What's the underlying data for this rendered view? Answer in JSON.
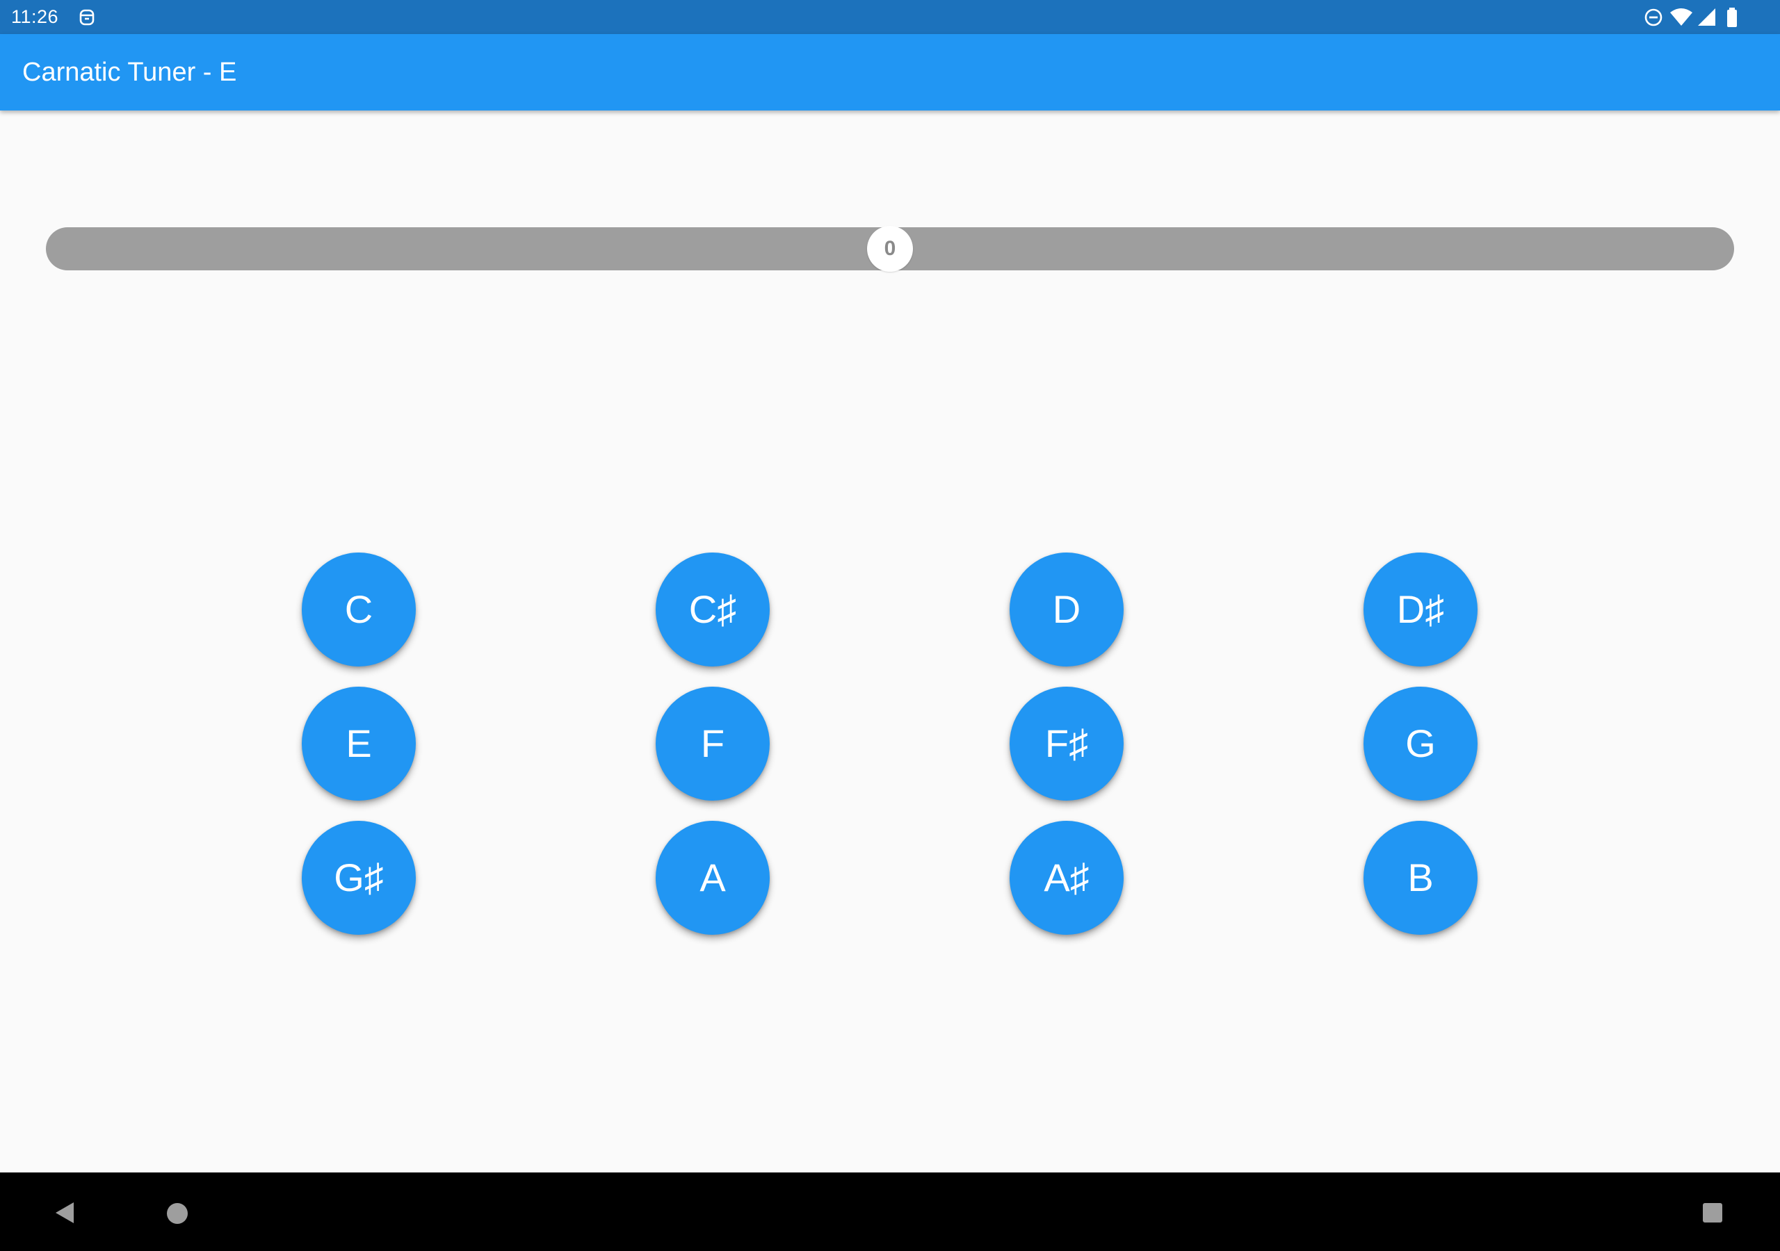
{
  "status_bar": {
    "time": "11:26",
    "left_icons": [
      "notification-icon"
    ],
    "right_icons": [
      "do-not-disturb-icon",
      "wifi-icon",
      "cell-signal-icon",
      "battery-icon"
    ]
  },
  "app_bar": {
    "title": "Carnatic Tuner - E"
  },
  "meter": {
    "value": "0",
    "position_fraction": 0.5
  },
  "notes": [
    {
      "label": "C"
    },
    {
      "label": "C♯"
    },
    {
      "label": "D"
    },
    {
      "label": "D♯"
    },
    {
      "label": "E"
    },
    {
      "label": "F"
    },
    {
      "label": "F♯"
    },
    {
      "label": "G"
    },
    {
      "label": "G♯"
    },
    {
      "label": "A"
    },
    {
      "label": "A♯"
    },
    {
      "label": "B"
    }
  ],
  "nav_bar": {
    "icons": [
      "back-icon",
      "home-icon",
      "recents-icon"
    ]
  },
  "colors": {
    "status_bar": "#1c72bc",
    "primary": "#2196f3",
    "background": "#fafafa",
    "meter_track": "#9e9e9e",
    "nav_bar": "#000000"
  }
}
